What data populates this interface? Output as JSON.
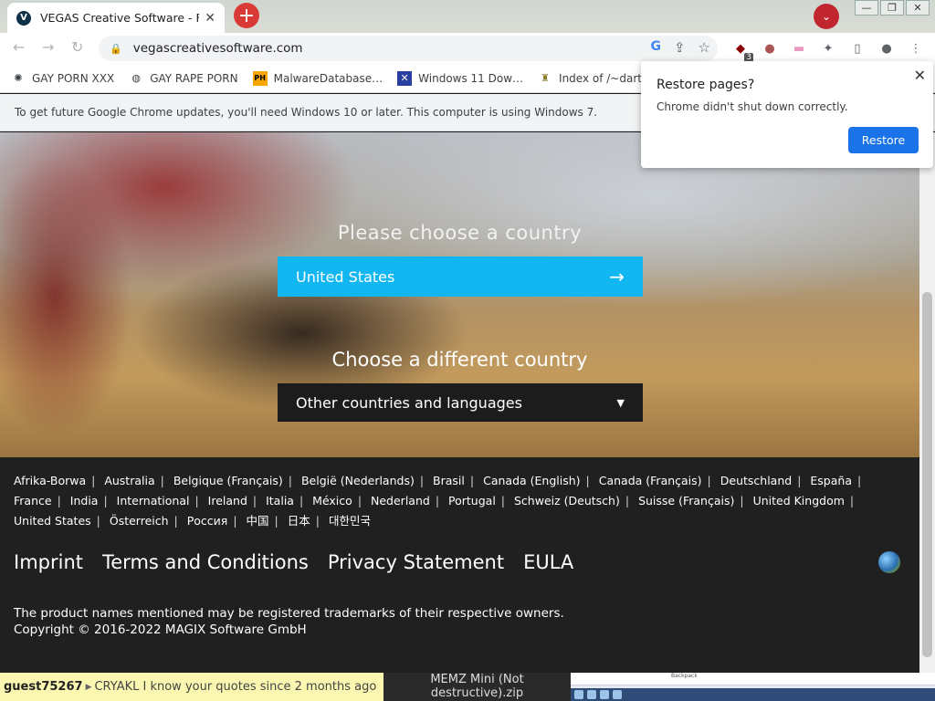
{
  "browser": {
    "tab": {
      "favicon": "V",
      "title": "VEGAS Creative Software - Fa",
      "close": "✕"
    },
    "new_tab": "+",
    "tab_search": "⌄",
    "window_buttons": {
      "minimize": "—",
      "restore": "❐",
      "close": "✕"
    },
    "url": "vegascreativesoftware.com",
    "nav": {
      "back": "←",
      "forward": "→",
      "reload": "↻"
    },
    "omnibox_icons": {
      "google": "G",
      "share": "⇪",
      "bookmark_star": "☆"
    },
    "extensions": {
      "badge": "3"
    },
    "bookmarks": [
      {
        "label": "GAY PORN XXX",
        "icon": "spider-icon"
      },
      {
        "label": "GAY RAPE PORN",
        "icon": "globe-icon"
      },
      {
        "label": "MalwareDatabase…",
        "icon": "ph-icon"
      },
      {
        "label": "Windows 11 Dow…",
        "icon": "x-icon"
      },
      {
        "label": "Index of /~dartz",
        "icon": "folder-icon"
      }
    ],
    "infobar_text": "To get future Google Chrome updates, you'll need Windows 10 or later. This computer is using Windows 7."
  },
  "restore_popup": {
    "title": "Restore pages?",
    "message": "Chrome didn't shut down correctly.",
    "button": "Restore",
    "close": "✕"
  },
  "hero": {
    "title": "Please choose a country",
    "selected_country": "United States",
    "arrow": "→",
    "title2": "Choose a different country",
    "other_select": "Other countries and languages",
    "caret": "▼"
  },
  "footer": {
    "countries": [
      "Afrika-Borwa",
      "Australia",
      "Belgique (Français)",
      "België (Nederlands)",
      "Brasil",
      "Canada (English)",
      "Canada (Français)",
      "Deutschland",
      "España",
      "France",
      "India",
      "International",
      "Ireland",
      "Italia",
      "México",
      "Nederland",
      "Portugal",
      "Schweiz (Deutsch)",
      "Suisse (Français)",
      "United Kingdom",
      "United States",
      "Österreich",
      "Россия",
      "中国",
      "日本",
      "대한민국"
    ],
    "separator": "|",
    "links": [
      "Imprint",
      "Terms and Conditions",
      "Privacy Statement",
      "EULA"
    ],
    "trademark": "The product names mentioned may be registered trademarks of their respective owners.",
    "copyright": "Copyright © 2016-2022 MAGIX Software GmbH"
  },
  "desktop": {
    "chat_user": "guest75267",
    "chat_caret": "▶",
    "chat_message": "CRYAKL I know your quotes since 2 months ago",
    "file_name": "MEMZ Mini (Not destructive).zip",
    "thumb_title": "Backpack"
  },
  "colors": {
    "accent_blue": "#12b6f0",
    "restore_blue": "#1a73e8",
    "footer_bg": "#202020"
  }
}
